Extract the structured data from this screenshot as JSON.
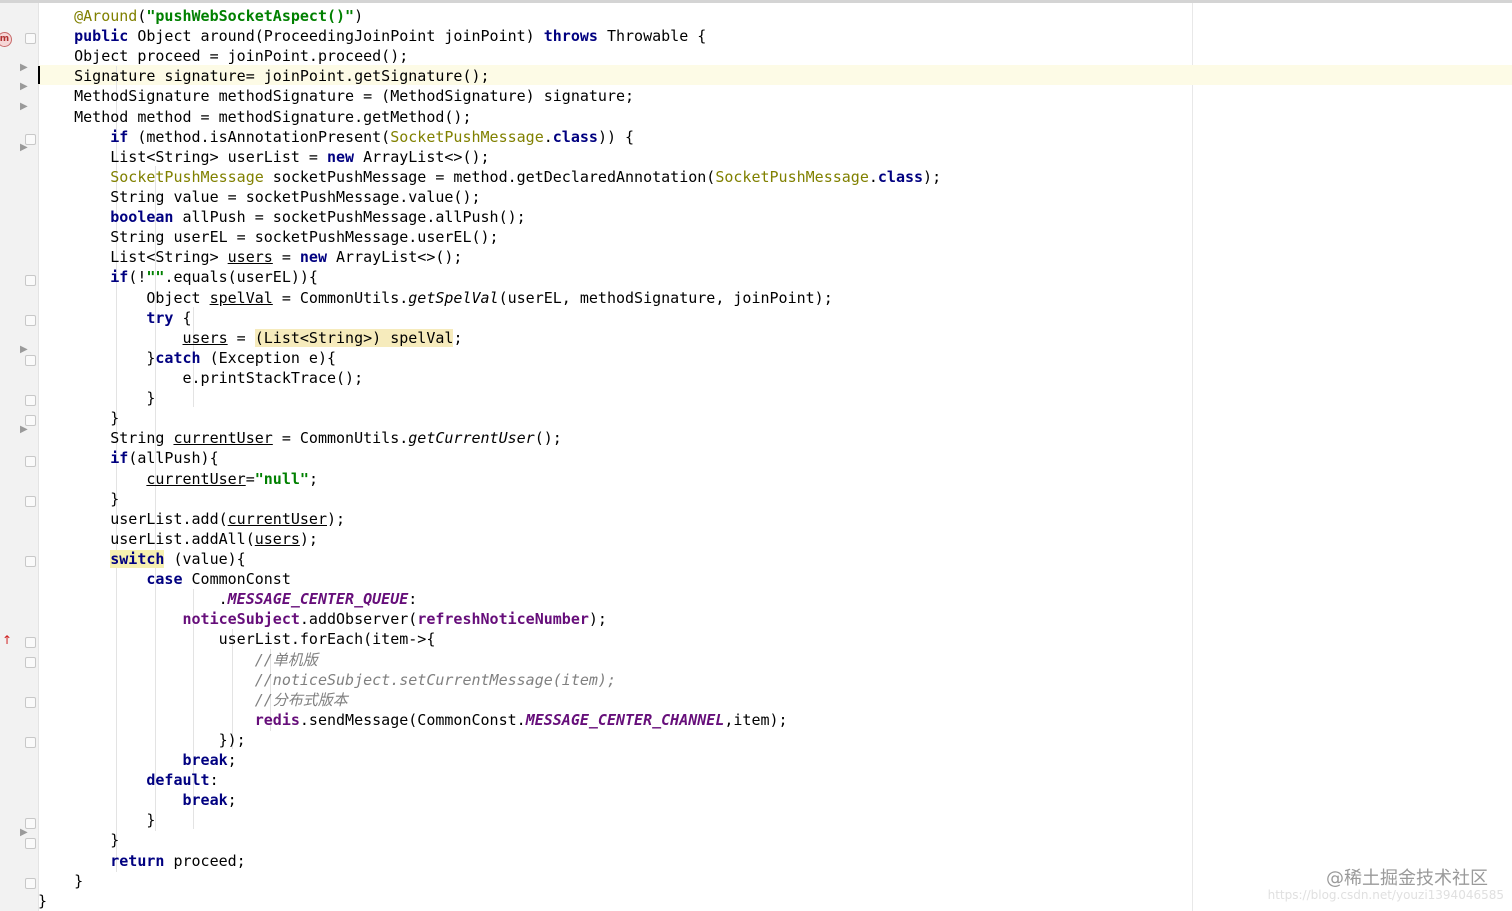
{
  "editor": {
    "gutter_icons": {
      "method_marker": "m",
      "override_marker": "↑"
    },
    "code": {
      "l1_ann": "@Around",
      "l1_open": "(",
      "l1_str": "\"pushWebSocketAspect()\"",
      "l1_close": ")",
      "kw_public": "public",
      "l2_sig": " Object around(ProceedingJoinPoint joinPoint) ",
      "kw_throws": "throws",
      "l2_end": " Throwable {",
      "l3": "    Object proceed = joinPoint.proceed();",
      "l4": "    Signature signature= joinPoint.getSignature();",
      "l5": "    MethodSignature methodSignature = (MethodSignature) signature;",
      "l6": "    Method method = methodSignature.getMethod();",
      "kw_if": "if",
      "l7_a": " (method.isAnnotationPresent(",
      "ann_spm": "SocketPushMessage",
      "dot": ".",
      "kw_class": "class",
      "l7_end": ")) {",
      "l8_a": "        List<String> userList = ",
      "kw_new": "new",
      "l8_b": " ArrayList<>();",
      "l9_b": " socketPushMessage = method.getDeclaredAnnotation(",
      "l9_end": ");",
      "l10": "        String value = socketPushMessage.value();",
      "kw_boolean": "boolean",
      "l11_b": " allPush = socketPushMessage.allPush();",
      "l12": "        String userEL = socketPushMessage.userEL();",
      "l13_a": "        List<String> ",
      "v_users": "users",
      "l13_b": " = ",
      "l14_a": "(!",
      "str_empty": "\"\"",
      "l14_b": ".equals(userEL)){",
      "l15_a": "            Object ",
      "v_spelVal": "spelVal",
      "l15_b": " = CommonUtils.",
      "m_getSpelVal": "getSpelVal",
      "l15_c": "(userEL, methodSignature, joinPoint);",
      "kw_try": "try",
      "l16_b": " {",
      "l17_b": " = ",
      "l17_hl": "(List<String>) spelVal",
      "semi": ";",
      "brace_close": "}",
      "kw_catch": "catch",
      "l18_b": " (Exception e){",
      "l19": "                e.printStackTrace();",
      "l22_a": "        String ",
      "v_currentUser": "currentUser",
      "l22_b": " = CommonUtils.",
      "m_getCurrentUser": "getCurrentUser",
      "l22_c": "();",
      "l23_b": "(allPush){",
      "eq": "=",
      "str_null": "\"null\"",
      "l26_a": "        userList.add(",
      "l26_b": ");",
      "l27_a": "        userList.addAll(",
      "kw_switch": "switch",
      "l28_b": " (value){",
      "kw_case": "case",
      "l29_b": " CommonConst",
      "f_queue": "MESSAGE_CENTER_QUEUE",
      "colon": ":",
      "f_noticeSubject": "noticeSubject",
      "l31_b": ".addObserver(",
      "f_refresh": "refreshNoticeNumber",
      "l32": "                    userList.forEach(item->{",
      "c_single": "//单机版",
      "c_notice": "//noticeSubject.setCurrentMessage(item);",
      "c_dist": "//分布式版本",
      "f_redis": "redis",
      "l36_b": ".sendMessage(CommonConst.",
      "f_channel": "MESSAGE_CENTER_CHANNEL",
      "l36_c": ",item);",
      "l37": "                    });",
      "kw_break": "break",
      "kw_default": "default",
      "kw_return": "return",
      "l44_b": " proceed;"
    }
  },
  "watermark": {
    "text": "@稀土掘金技术社区",
    "url": "https://blog.csdn.net/youzi1394046585"
  }
}
